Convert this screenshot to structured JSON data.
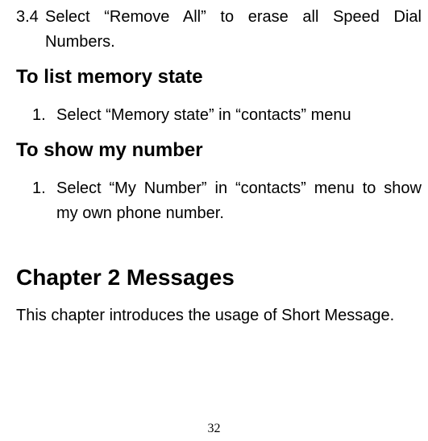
{
  "item34": {
    "num": "3.4",
    "text": "Select “Remove All” to erase all Speed Dial Numbers."
  },
  "heading_memory": "To list memory state",
  "memory_item": {
    "num": "1.",
    "text": "Select “Memory state” in “contacts” menu"
  },
  "heading_mynumber": "To show my number",
  "mynumber_item": {
    "num": "1.",
    "text": "Select “My Number” in “contacts” menu to show my own phone number."
  },
  "chapter_title": "Chapter 2 Messages",
  "chapter_intro": "This chapter introduces the usage of Short Message.",
  "page_number": "32"
}
